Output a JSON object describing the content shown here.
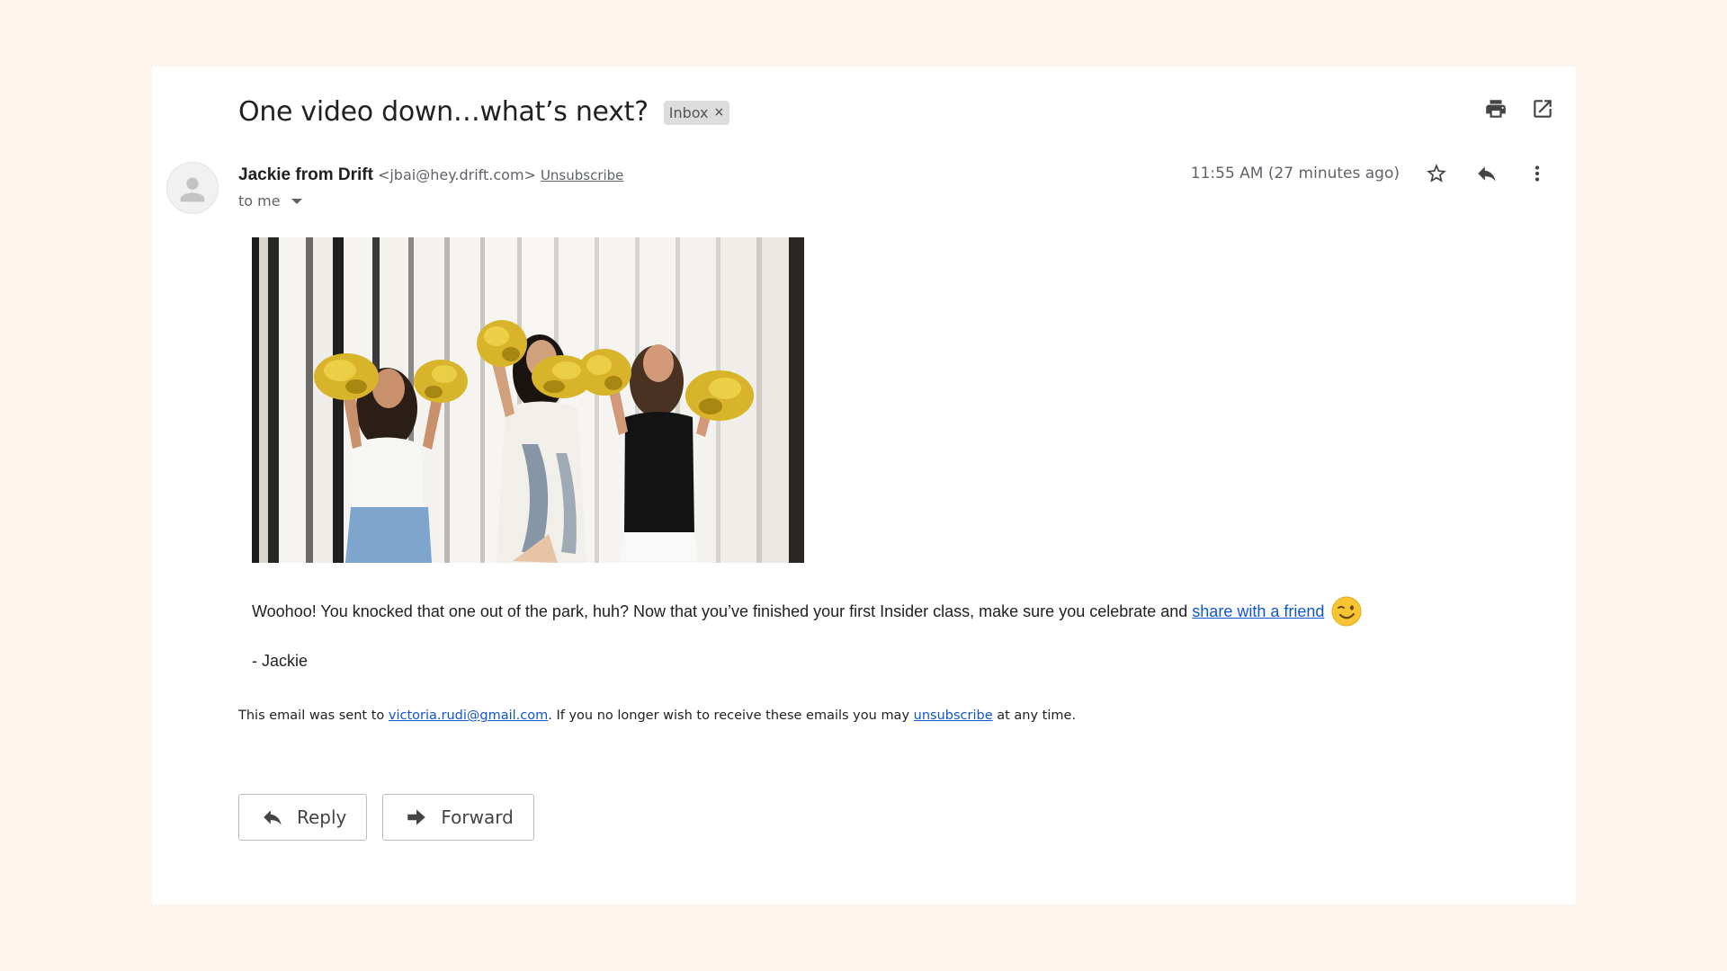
{
  "email": {
    "subject": "One video down…what’s next?",
    "label": "Inbox",
    "label_remove": "×",
    "sender_name": "Jackie from Drift",
    "sender_email": "<jbai@hey.drift.com>",
    "unsubscribe_header": "Unsubscribe",
    "recipient": "to me",
    "timestamp": "11:55 AM (27 minutes ago)",
    "body_text": "Woohoo! You knocked that one out of the park, huh? Now that you’ve finished your first Insider class, make sure you celebrate and",
    "body_link": "share with a friend",
    "signature": "- Jackie",
    "footer_prefix": "This email was sent to",
    "footer_email": "victoria.rudi@gmail.com",
    "footer_middle": ". If you no longer wish to receive these emails you may",
    "footer_unsubscribe": "unsubscribe",
    "footer_suffix": "at any time."
  },
  "icons": {
    "print": "print-icon",
    "open_new_window": "open-in-new-window-icon",
    "avatar": "person-avatar-icon",
    "star": "star-icon",
    "reply": "reply-icon",
    "more": "more-vertical-icon",
    "emoji": "winking-face-emoji",
    "forward": "forward-icon"
  },
  "actions": {
    "reply_label": "Reply",
    "forward_label": "Forward"
  },
  "colors": {
    "page_background": "#fdf4ee",
    "link": "#1155cc",
    "label_chip": "#dddddd"
  }
}
